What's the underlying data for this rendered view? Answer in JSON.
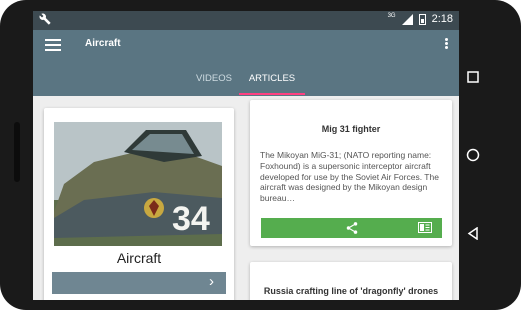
{
  "status_bar": {
    "time": "2:18",
    "network_label": "3G",
    "wrench_icon": "wrench-icon"
  },
  "toolbar": {
    "title": "Aircraft",
    "menu_icon": "hamburger-icon",
    "overflow_icon": "more-vert-icon"
  },
  "tabs": [
    {
      "label": "VIDEOS",
      "selected": false
    },
    {
      "label": "ARTICLES",
      "selected": true
    }
  ],
  "colors": {
    "toolbar": "#5a7582",
    "status_bar": "#3d4a51",
    "tab_indicator": "#ff4081",
    "action_green": "#55ad4e",
    "card_button": "#6f8692"
  },
  "cards": {
    "left": {
      "title": "Aircraft",
      "image_text": "34",
      "button_icon": "chevron-right-icon"
    },
    "right1": {
      "title": "Mig 31 fighter",
      "body": "The Mikoyan MiG-31; (NATO reporting name: Foxhound) is a supersonic interceptor aircraft developed for use by the Soviet Air Forces. The aircraft was designed by the Mikoyan design bureau…",
      "actions": [
        "share-icon",
        "read-icon"
      ]
    },
    "right2": {
      "title": "Russia crafting line of 'dragonfly' drones"
    }
  },
  "nav_bar": [
    "recents-square-icon",
    "home-circle-icon",
    "back-triangle-icon"
  ]
}
